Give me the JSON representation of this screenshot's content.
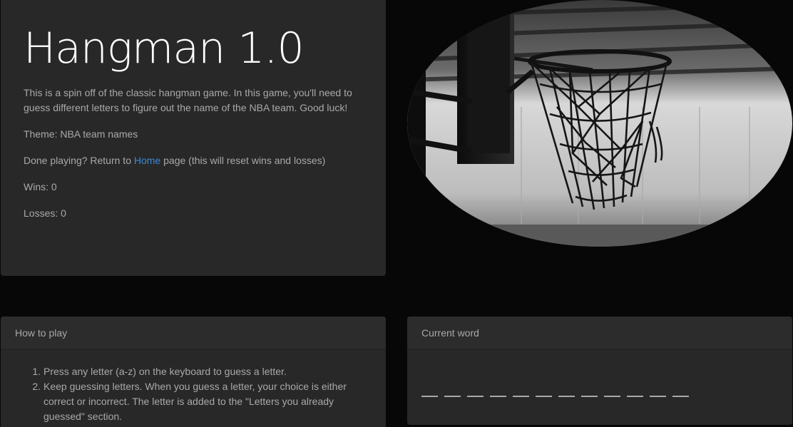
{
  "jumbotron": {
    "title": "Hangman 1.0",
    "intro": "This is a spin off of the classic hangman game. In this game, you'll need to guess different letters to figure out the name of the NBA team. Good luck!",
    "theme": "Theme: NBA team names",
    "done_prefix": "Done playing? Return to ",
    "home_link": "Home",
    "done_suffix": " page (this will reset wins and losses)",
    "wins": "Wins: 0",
    "losses": "Losses: 0"
  },
  "hero_image": {
    "subject": "basketball-hoop-photo"
  },
  "how_to_play": {
    "header": "How to play",
    "steps": [
      "Press any letter (a-z) on the keyboard to guess a letter.",
      "Keep guessing letters. When you guess a letter, your choice is either correct or incorrect. The letter is added to the \"Letters you already guessed\" section."
    ]
  },
  "current_word": {
    "header": "Current word",
    "blanks": [
      "_",
      "_",
      "_",
      "_",
      "_",
      "_",
      "_",
      "_",
      "_",
      "_",
      "_",
      "_"
    ]
  },
  "colors": {
    "background": "#070707",
    "panel": "#282828",
    "link": "#3a8bd8",
    "title": "#ffffff"
  }
}
